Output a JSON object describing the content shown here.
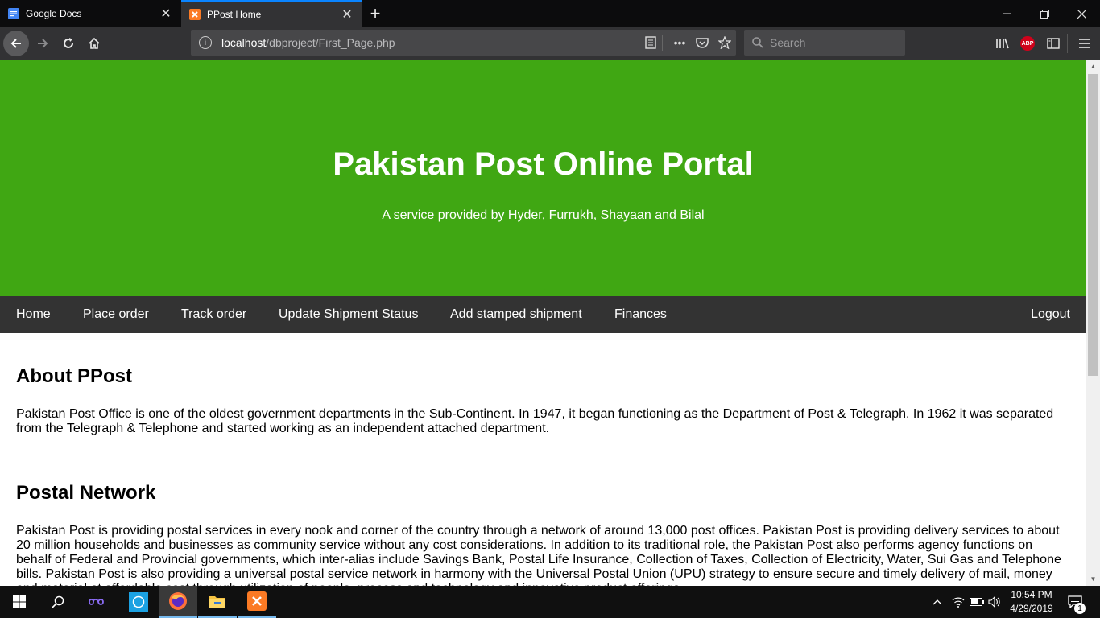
{
  "browser": {
    "tabs": [
      {
        "title": "Google Docs",
        "active": false
      },
      {
        "title": "PPost Home",
        "active": true
      }
    ],
    "url": {
      "host": "localhost",
      "path": "/dbproject/First_Page.php"
    },
    "search_placeholder": "Search"
  },
  "page": {
    "hero": {
      "title": "Pakistan Post Online Portal",
      "subtitle": "A service provided by Hyder, Furrukh, Shayaan and Bilal",
      "bg_color": "#40a713"
    },
    "nav": {
      "items": [
        "Home",
        "Place order",
        "Track order",
        "Update Shipment Status",
        "Add stamped shipment",
        "Finances"
      ],
      "logout": "Logout",
      "bg_color": "#333333"
    },
    "sections": [
      {
        "heading": "About PPost",
        "body": "Pakistan Post Office is one of the oldest government departments in the Sub-Continent. In 1947, it began functioning as the Department of Post & Telegraph. In 1962 it was separated from the Telegraph & Telephone and started working as an independent attached department."
      },
      {
        "heading": "Postal Network",
        "body": "Pakistan Post is providing postal services in every nook and corner of the country through a network of around 13,000 post offices. Pakistan Post is providing delivery services to about 20 million households and businesses as community service without any cost considerations. In addition to its traditional role, the Pakistan Post also performs agency functions on behalf of Federal and Provincial governments, which inter-alias include Savings Bank, Postal Life Insurance, Collection of Taxes, Collection of Electricity, Water, Sui Gas and Telephone bills. Pakistan Post is also providing a universal postal service network in harmony with the Universal Postal Union (UPU) strategy to ensure secure and timely delivery of mail, money and material at affordable cost through utilization of people, process and technology and innovative product offerings."
      }
    ]
  },
  "taskbar": {
    "time": "10:54 PM",
    "date": "4/29/2019",
    "notification_count": "1"
  }
}
